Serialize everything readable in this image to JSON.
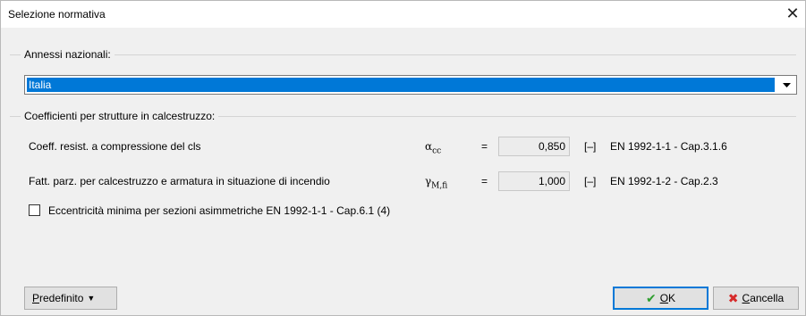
{
  "window": {
    "title": "Selezione normativa"
  },
  "annexes": {
    "legend": "Annessi nazionali:",
    "selected": "Italia"
  },
  "coefficients": {
    "legend": "Coefficienti per strutture in calcestruzzo:",
    "rows": [
      {
        "label": "Coeff. resist. a compressione del cls",
        "symbol_base": "α",
        "symbol_sub": "cc",
        "equals": "=",
        "value": "0,850",
        "unit": "[–]",
        "reference": "EN 1992-1-1 - Cap.3.1.6"
      },
      {
        "label": "Fatt. parz. per calcestruzzo e armatura in situazione di incendio",
        "symbol_base": "γ",
        "symbol_sub": "M,fi",
        "equals": "=",
        "value": "1,000",
        "unit": "[–]",
        "reference": "EN 1992-1-2 - Cap.2.3"
      }
    ],
    "checkbox_label": "Eccentricità minima per sezioni asimmetriche EN 1992-1-1 - Cap.6.1 (4)",
    "checkbox_checked": false
  },
  "buttons": {
    "default_first": "P",
    "default_rest": "redefinito",
    "ok_first": "O",
    "ok_rest": "K",
    "cancel_first": "C",
    "cancel_rest": "ancella"
  },
  "colors": {
    "selection": "#0078d7",
    "ok_check": "#2e9e2e",
    "cancel_x": "#d62b2b"
  }
}
